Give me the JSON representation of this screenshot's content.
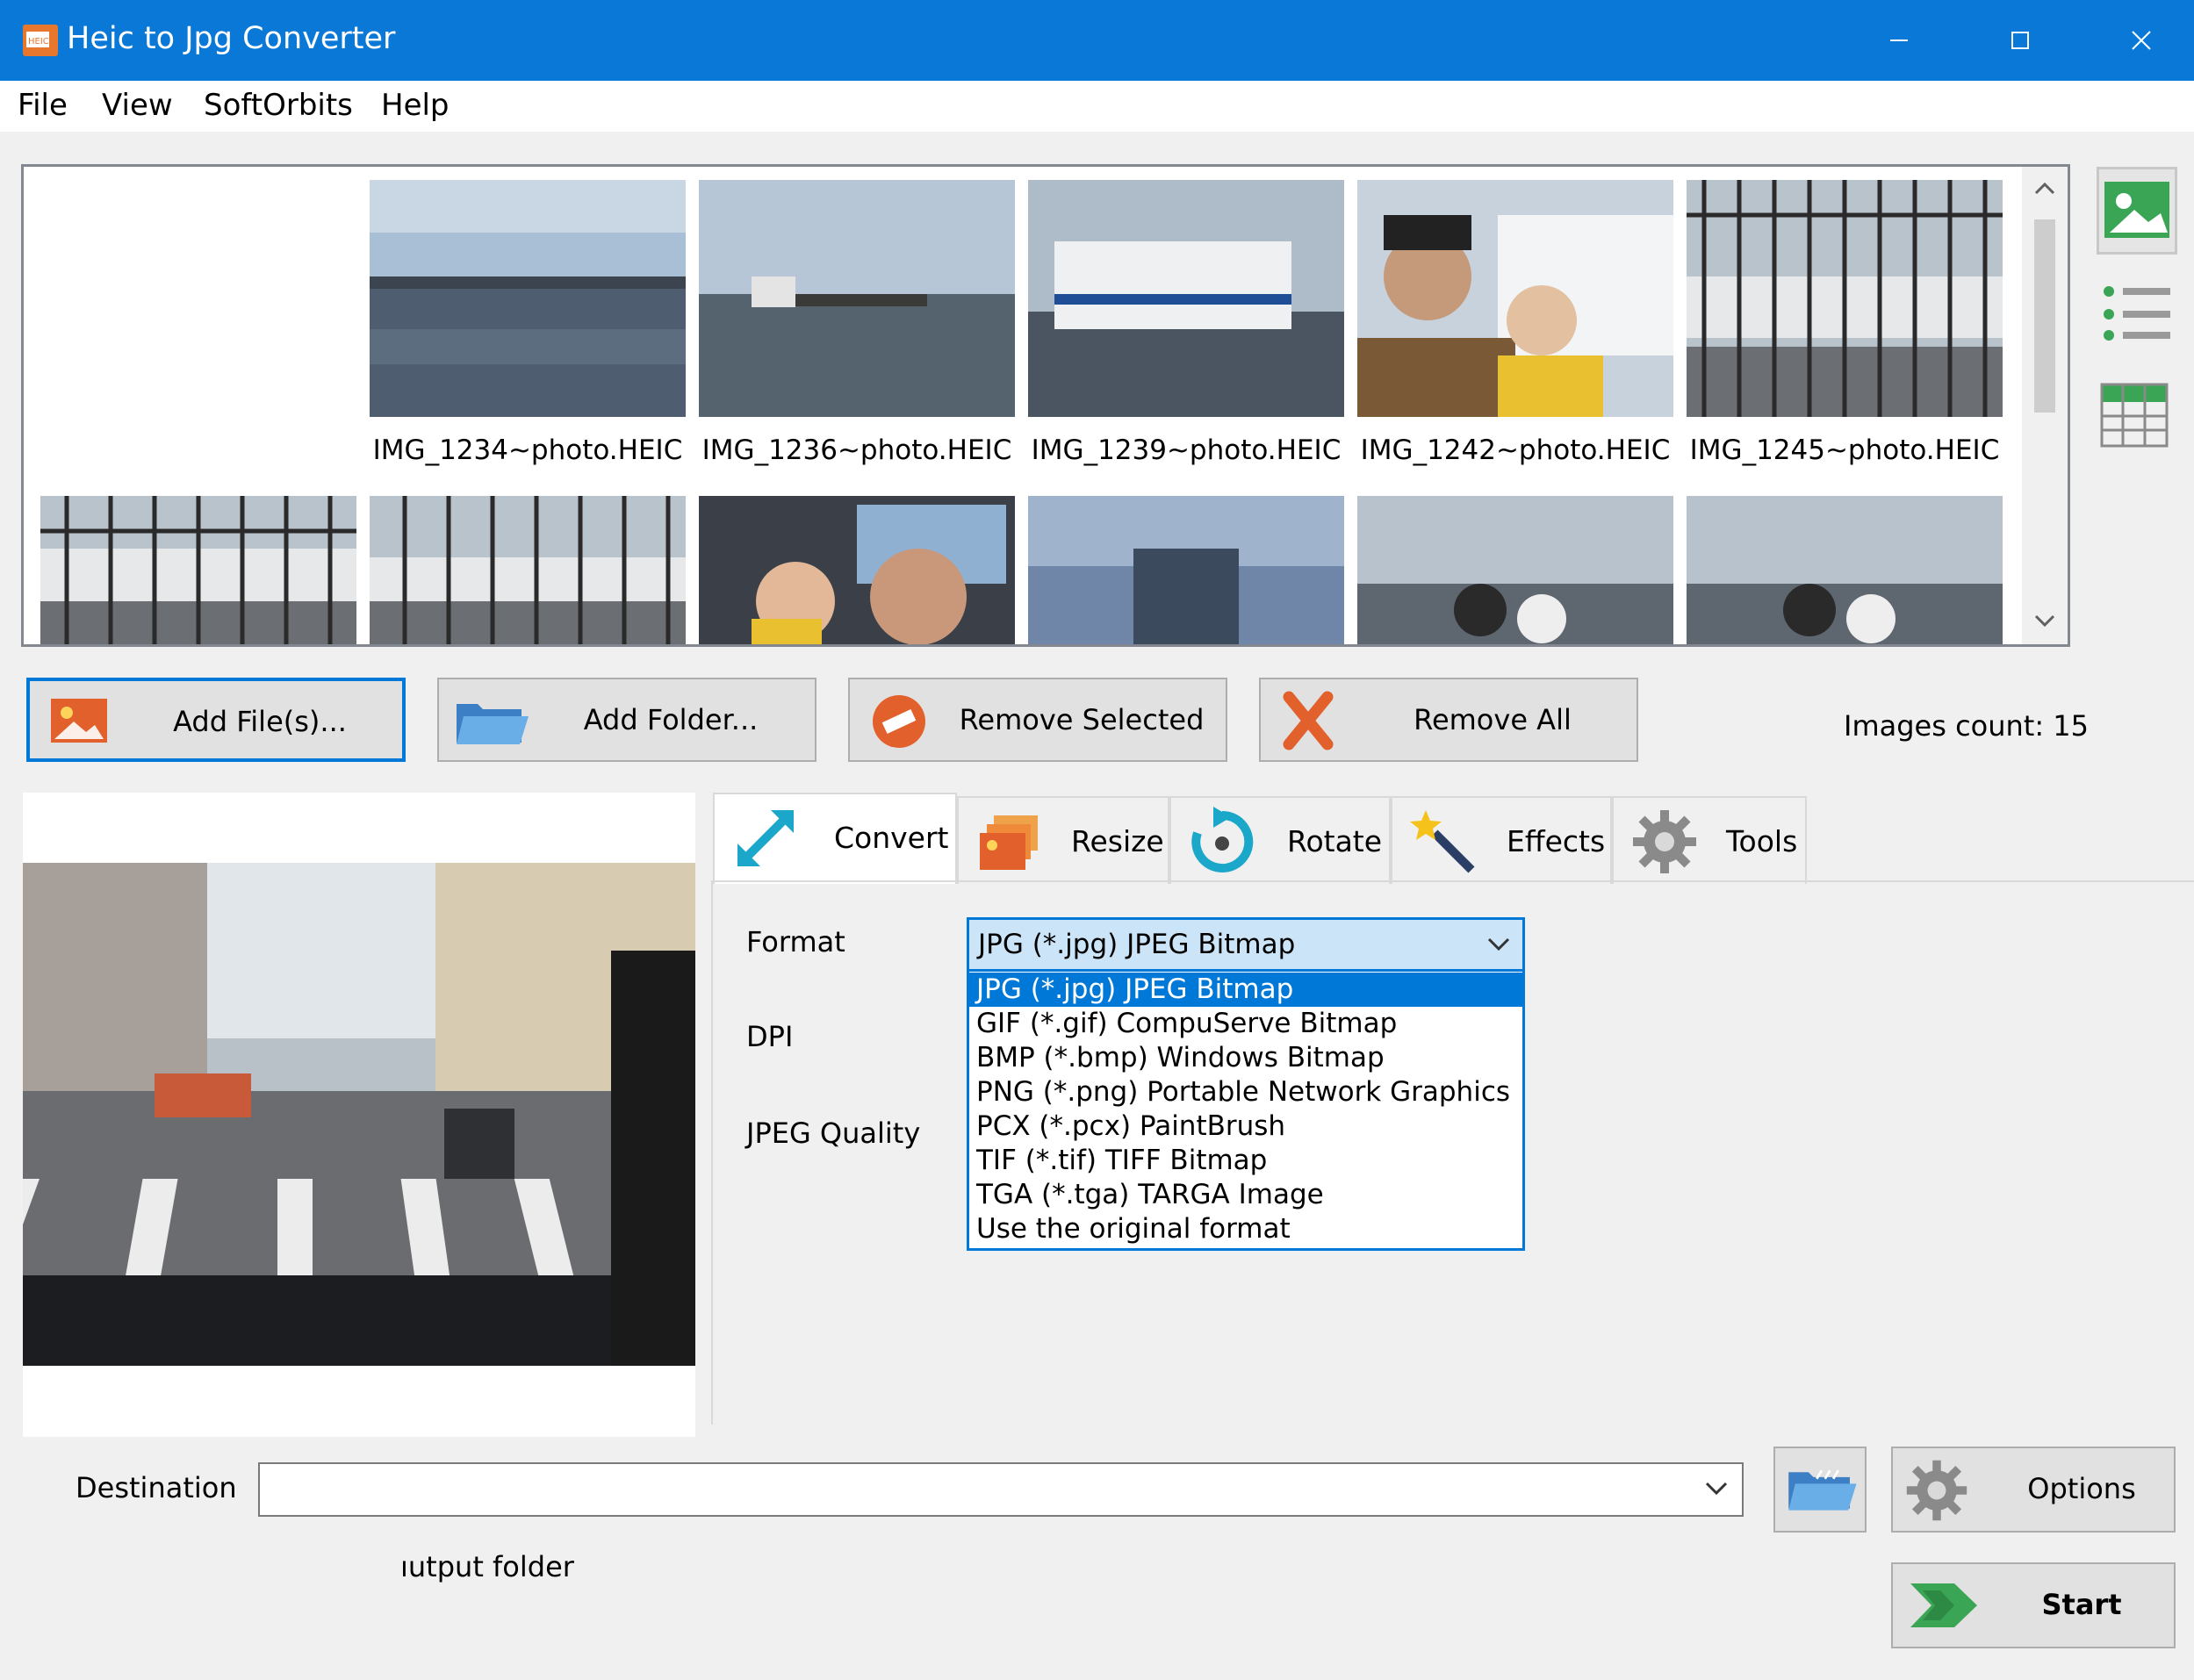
{
  "window": {
    "title": "Heic to Jpg Converter",
    "controls": [
      "minimize",
      "maximize",
      "close"
    ],
    "accent_color": "#0a78d7"
  },
  "menu": {
    "file": "File",
    "view": "View",
    "softorbits": "SoftOrbits",
    "help": "Help"
  },
  "thumbnails": {
    "row1": [
      {
        "label": "IMG_1234~photo.HEIC"
      },
      {
        "label": "IMG_1236~photo.HEIC"
      },
      {
        "label": "IMG_1239~photo.HEIC"
      },
      {
        "label": "IMG_1242~photo.HEIC"
      },
      {
        "label": "IMG_1245~photo.HEIC"
      }
    ]
  },
  "toolbar": {
    "add_files": "Add File(s)...",
    "add_folder": "Add Folder...",
    "remove_selected": "Remove Selected",
    "remove_all": "Remove All",
    "images_count": "Images count: 15"
  },
  "tabs": {
    "convert": "Convert",
    "resize": "Resize",
    "rotate": "Rotate",
    "effects": "Effects",
    "tools": "Tools"
  },
  "convert": {
    "format_label": "Format",
    "dpi_label": "DPI",
    "jpeg_quality_label": "JPEG Quality",
    "format_selected": "JPG (*.jpg) JPEG Bitmap",
    "format_options": [
      "JPG (*.jpg) JPEG Bitmap",
      "GIF (*.gif) CompuServe Bitmap",
      "BMP (*.bmp) Windows Bitmap",
      "PNG (*.png) Portable Network Graphics",
      "PCX (*.pcx) PaintBrush",
      "TIF (*.tif) TIFF Bitmap",
      "TGA (*.tga) TARGA Image",
      "Use the original format"
    ]
  },
  "bottom": {
    "destination_label": "Destination",
    "destination_value": "",
    "output_folder_text": "ıutput folder",
    "options": "Options",
    "start": "Start"
  }
}
